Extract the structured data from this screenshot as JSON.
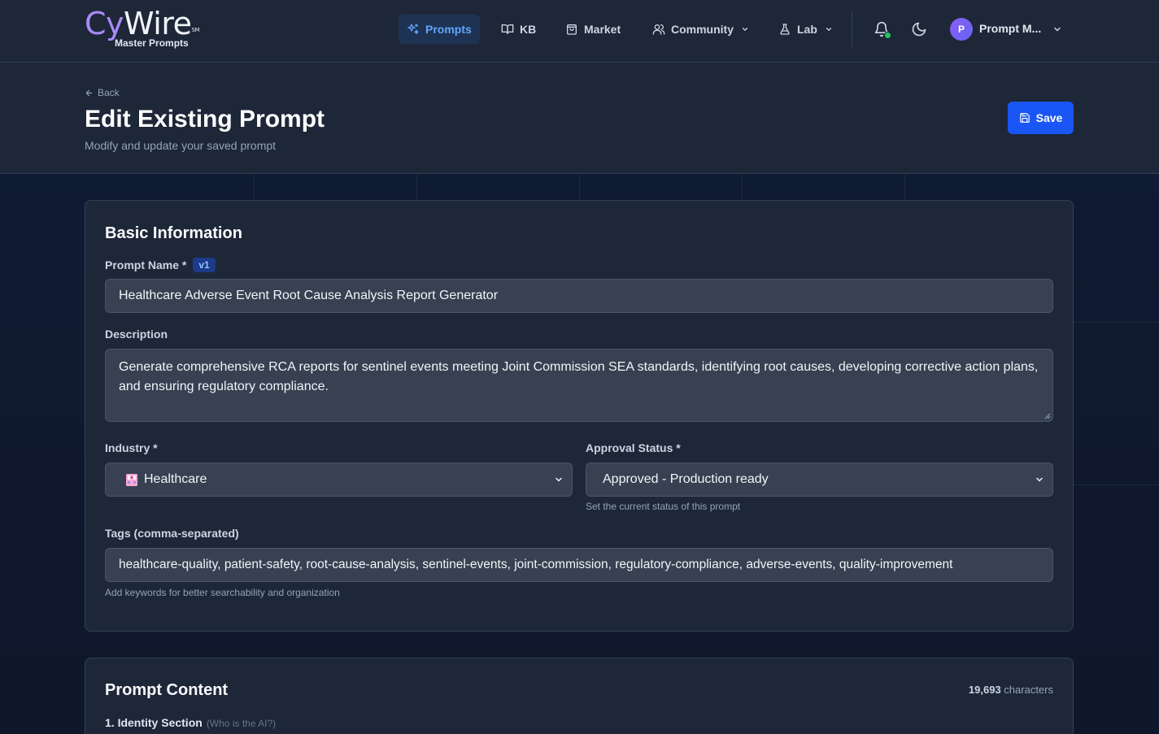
{
  "nav": {
    "logo_cy": "Cy",
    "logo_wire": "Wire",
    "logo_sm": "SM",
    "logo_sub": "Master Prompts",
    "items": [
      {
        "label": "Prompts",
        "icon": "sparkles-icon"
      },
      {
        "label": "KB",
        "icon": "book-icon"
      },
      {
        "label": "Market",
        "icon": "shopping-bag-icon"
      },
      {
        "label": "Community",
        "icon": "users-icon"
      },
      {
        "label": "Lab",
        "icon": "flask-icon"
      }
    ],
    "avatar_initial": "P",
    "user_name": "Prompt M..."
  },
  "header": {
    "back_label": "Back",
    "title": "Edit Existing Prompt",
    "subtitle": "Modify and update your saved prompt",
    "save_label": "Save"
  },
  "basic_info": {
    "title": "Basic Information",
    "prompt_name_label": "Prompt Name *",
    "version_badge": "v1",
    "prompt_name_value": "Healthcare Adverse Event Root Cause Analysis Report Generator",
    "description_label": "Description",
    "description_value": "Generate comprehensive RCA reports for sentinel events meeting Joint Commission SEA standards, identifying root causes, developing corrective action plans, and ensuring regulatory compliance.",
    "industry_label": "Industry *",
    "industry_value": "Healthcare",
    "approval_label": "Approval Status *",
    "approval_value": "Approved - Production ready",
    "approval_hint": "Set the current status of this prompt",
    "tags_label": "Tags (comma-separated)",
    "tags_value": "healthcare-quality, patient-safety, root-cause-analysis, sentinel-events, joint-commission, regulatory-compliance, adverse-events, quality-improvement",
    "tags_hint": "Add keywords for better searchability and organization"
  },
  "prompt_content": {
    "title": "Prompt Content",
    "char_count_number": "19,693",
    "char_count_suffix": "characters",
    "section1_label": "1. Identity Section",
    "section1_hint": "(Who is the AI?)"
  },
  "colors": {
    "accent": "#1a56f5",
    "brand_purple": "#a78bfa",
    "status_green": "#22c55e"
  }
}
